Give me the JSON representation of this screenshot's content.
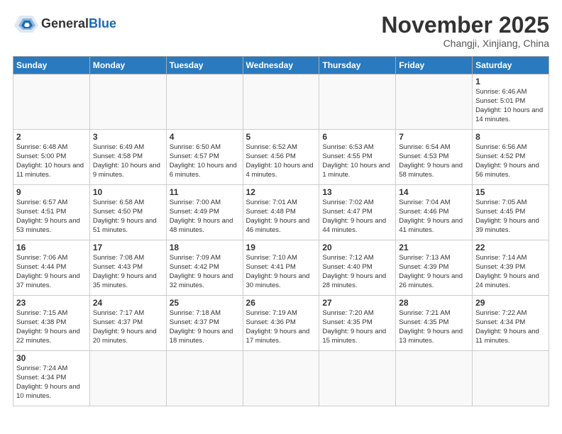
{
  "header": {
    "logo_general": "General",
    "logo_blue": "Blue",
    "month_title": "November 2025",
    "location": "Changji, Xinjiang, China"
  },
  "weekdays": [
    "Sunday",
    "Monday",
    "Tuesday",
    "Wednesday",
    "Thursday",
    "Friday",
    "Saturday"
  ],
  "weeks": [
    [
      {
        "day": "",
        "info": ""
      },
      {
        "day": "",
        "info": ""
      },
      {
        "day": "",
        "info": ""
      },
      {
        "day": "",
        "info": ""
      },
      {
        "day": "",
        "info": ""
      },
      {
        "day": "",
        "info": ""
      },
      {
        "day": "1",
        "info": "Sunrise: 6:46 AM\nSunset: 5:01 PM\nDaylight: 10 hours and 14 minutes."
      }
    ],
    [
      {
        "day": "2",
        "info": "Sunrise: 6:48 AM\nSunset: 5:00 PM\nDaylight: 10 hours and 11 minutes."
      },
      {
        "day": "3",
        "info": "Sunrise: 6:49 AM\nSunset: 4:58 PM\nDaylight: 10 hours and 9 minutes."
      },
      {
        "day": "4",
        "info": "Sunrise: 6:50 AM\nSunset: 4:57 PM\nDaylight: 10 hours and 6 minutes."
      },
      {
        "day": "5",
        "info": "Sunrise: 6:52 AM\nSunset: 4:56 PM\nDaylight: 10 hours and 4 minutes."
      },
      {
        "day": "6",
        "info": "Sunrise: 6:53 AM\nSunset: 4:55 PM\nDaylight: 10 hours and 1 minute."
      },
      {
        "day": "7",
        "info": "Sunrise: 6:54 AM\nSunset: 4:53 PM\nDaylight: 9 hours and 58 minutes."
      },
      {
        "day": "8",
        "info": "Sunrise: 6:56 AM\nSunset: 4:52 PM\nDaylight: 9 hours and 56 minutes."
      }
    ],
    [
      {
        "day": "9",
        "info": "Sunrise: 6:57 AM\nSunset: 4:51 PM\nDaylight: 9 hours and 53 minutes."
      },
      {
        "day": "10",
        "info": "Sunrise: 6:58 AM\nSunset: 4:50 PM\nDaylight: 9 hours and 51 minutes."
      },
      {
        "day": "11",
        "info": "Sunrise: 7:00 AM\nSunset: 4:49 PM\nDaylight: 9 hours and 48 minutes."
      },
      {
        "day": "12",
        "info": "Sunrise: 7:01 AM\nSunset: 4:48 PM\nDaylight: 9 hours and 46 minutes."
      },
      {
        "day": "13",
        "info": "Sunrise: 7:02 AM\nSunset: 4:47 PM\nDaylight: 9 hours and 44 minutes."
      },
      {
        "day": "14",
        "info": "Sunrise: 7:04 AM\nSunset: 4:46 PM\nDaylight: 9 hours and 41 minutes."
      },
      {
        "day": "15",
        "info": "Sunrise: 7:05 AM\nSunset: 4:45 PM\nDaylight: 9 hours and 39 minutes."
      }
    ],
    [
      {
        "day": "16",
        "info": "Sunrise: 7:06 AM\nSunset: 4:44 PM\nDaylight: 9 hours and 37 minutes."
      },
      {
        "day": "17",
        "info": "Sunrise: 7:08 AM\nSunset: 4:43 PM\nDaylight: 9 hours and 35 minutes."
      },
      {
        "day": "18",
        "info": "Sunrise: 7:09 AM\nSunset: 4:42 PM\nDaylight: 9 hours and 32 minutes."
      },
      {
        "day": "19",
        "info": "Sunrise: 7:10 AM\nSunset: 4:41 PM\nDaylight: 9 hours and 30 minutes."
      },
      {
        "day": "20",
        "info": "Sunrise: 7:12 AM\nSunset: 4:40 PM\nDaylight: 9 hours and 28 minutes."
      },
      {
        "day": "21",
        "info": "Sunrise: 7:13 AM\nSunset: 4:39 PM\nDaylight: 9 hours and 26 minutes."
      },
      {
        "day": "22",
        "info": "Sunrise: 7:14 AM\nSunset: 4:39 PM\nDaylight: 9 hours and 24 minutes."
      }
    ],
    [
      {
        "day": "23",
        "info": "Sunrise: 7:15 AM\nSunset: 4:38 PM\nDaylight: 9 hours and 22 minutes."
      },
      {
        "day": "24",
        "info": "Sunrise: 7:17 AM\nSunset: 4:37 PM\nDaylight: 9 hours and 20 minutes."
      },
      {
        "day": "25",
        "info": "Sunrise: 7:18 AM\nSunset: 4:37 PM\nDaylight: 9 hours and 18 minutes."
      },
      {
        "day": "26",
        "info": "Sunrise: 7:19 AM\nSunset: 4:36 PM\nDaylight: 9 hours and 17 minutes."
      },
      {
        "day": "27",
        "info": "Sunrise: 7:20 AM\nSunset: 4:35 PM\nDaylight: 9 hours and 15 minutes."
      },
      {
        "day": "28",
        "info": "Sunrise: 7:21 AM\nSunset: 4:35 PM\nDaylight: 9 hours and 13 minutes."
      },
      {
        "day": "29",
        "info": "Sunrise: 7:22 AM\nSunset: 4:34 PM\nDaylight: 9 hours and 11 minutes."
      }
    ],
    [
      {
        "day": "30",
        "info": "Sunrise: 7:24 AM\nSunset: 4:34 PM\nDaylight: 9 hours and 10 minutes."
      },
      {
        "day": "",
        "info": ""
      },
      {
        "day": "",
        "info": ""
      },
      {
        "day": "",
        "info": ""
      },
      {
        "day": "",
        "info": ""
      },
      {
        "day": "",
        "info": ""
      },
      {
        "day": "",
        "info": ""
      }
    ]
  ]
}
